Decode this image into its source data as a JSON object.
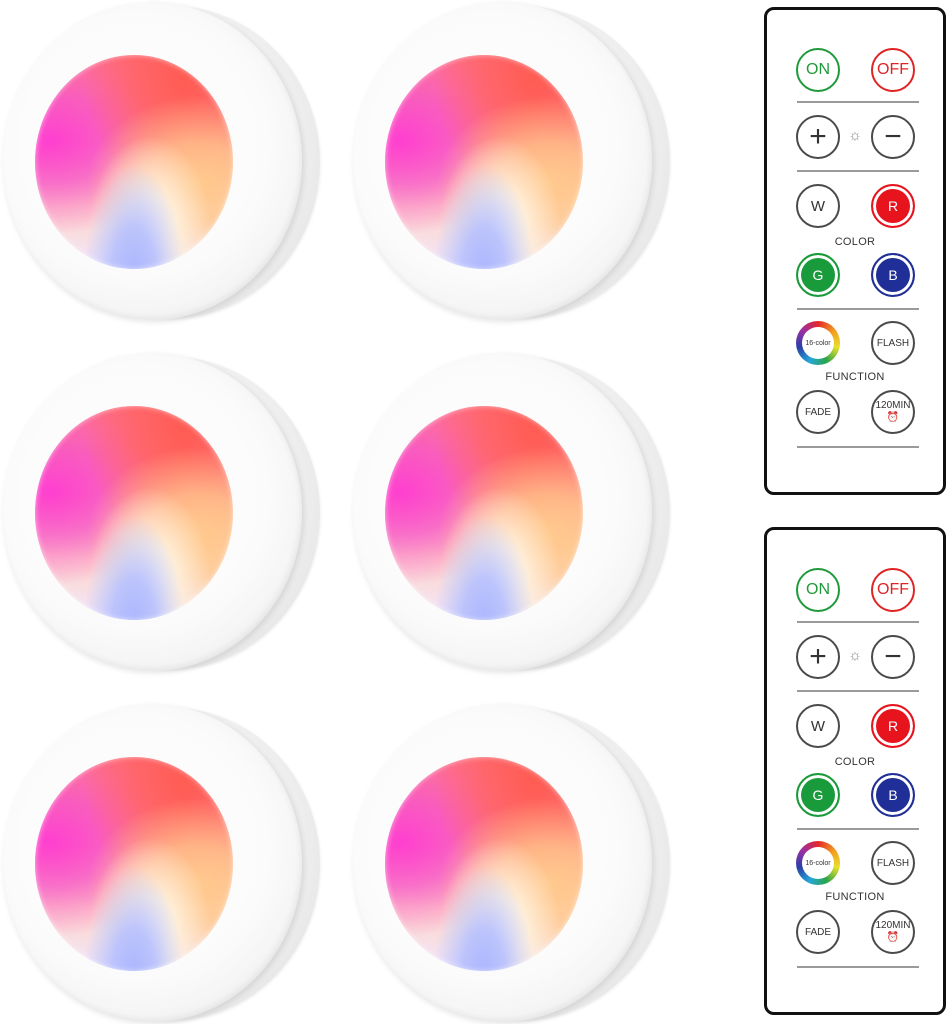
{
  "lights": [
    {
      "name": "puck-light-1"
    },
    {
      "name": "puck-light-2"
    },
    {
      "name": "puck-light-3"
    },
    {
      "name": "puck-light-4"
    },
    {
      "name": "puck-light-5"
    },
    {
      "name": "puck-light-6"
    }
  ],
  "remote": {
    "on_label": "ON",
    "off_label": "OFF",
    "plus_label": "+",
    "minus_label": "−",
    "brightness_symbol": "☼",
    "w_label": "W",
    "r_label": "R",
    "g_label": "G",
    "b_label": "B",
    "color_label": "COLOR",
    "sixteen_color_label": "16-color",
    "flash_label": "FLASH",
    "function_label": "FUNCTION",
    "fade_label": "FADE",
    "timer_label": "120MIN",
    "timer_icon": "⏰"
  },
  "colors": {
    "on_green": "#1f9a3a",
    "off_red": "#e02424",
    "red_button": "#e8141d",
    "green_button": "#1a9b3b",
    "blue_button": "#1f2f97"
  }
}
